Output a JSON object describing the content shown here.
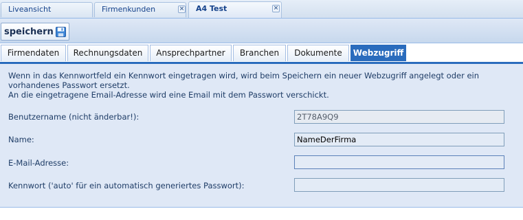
{
  "doc_tabs": [
    {
      "label": "Liveansicht",
      "closable": false
    },
    {
      "label": "Firmenkunden",
      "closable": true
    },
    {
      "label": "A4 Test",
      "closable": true,
      "active": true
    }
  ],
  "toolbar": {
    "save_label": "speichern",
    "save_icon": "floppy-disk-icon"
  },
  "section_tabs": [
    {
      "label": "Firmendaten"
    },
    {
      "label": "Rechnungsdaten"
    },
    {
      "label": "Ansprechpartner"
    },
    {
      "label": "Branchen"
    },
    {
      "label": "Dokumente"
    },
    {
      "label": "Webzugriff",
      "active": true
    }
  ],
  "info": {
    "line1": "Wenn in das Kennwortfeld ein Kennwort eingetragen wird, wird beim Speichern ein neuer Webzugriff angelegt oder ein vorhandenes Passwort ersetzt.",
    "line2": "An die eingetragene Email-Adresse wird eine Email mit dem Passwort verschickt."
  },
  "form": {
    "username": {
      "label": "Benutzername (nicht änderbar!):",
      "value": "2T78A9Q9"
    },
    "name": {
      "label": "Name:",
      "value": "NameDerFirma"
    },
    "email": {
      "label": "E-Mail-Adresse:",
      "value": ""
    },
    "password": {
      "label": "Kennwort ('auto' für ein automatisch generiertes Passwort):",
      "value": ""
    }
  },
  "colors": {
    "accent": "#2a6cbd",
    "panel_bg": "#dfe8f6",
    "tab_text": "#15428b"
  }
}
